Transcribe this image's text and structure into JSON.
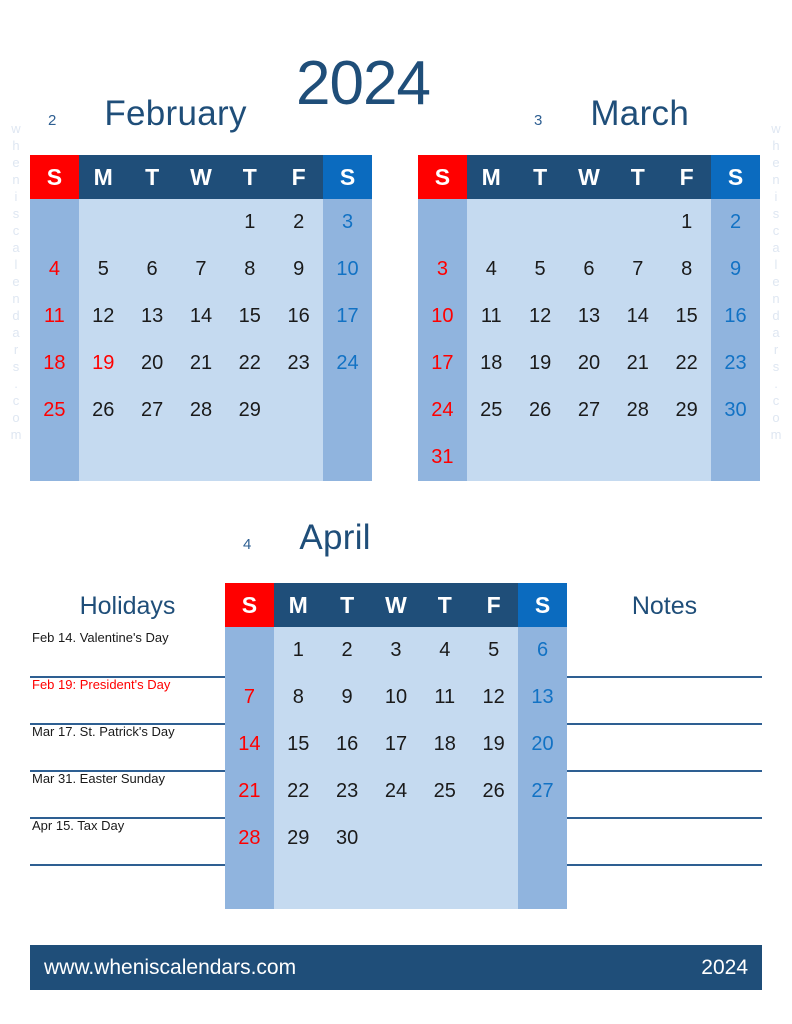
{
  "year": "2024",
  "watermark": "wheniscalendars.com",
  "weekdays": [
    "S",
    "M",
    "T",
    "W",
    "T",
    "F",
    "S"
  ],
  "months": [
    {
      "number": "2",
      "name": "February",
      "weeks": [
        [
          "",
          "",
          "",
          "",
          "1",
          "2",
          "3"
        ],
        [
          "4",
          "5",
          "6",
          "7",
          "8",
          "9",
          "10"
        ],
        [
          "11",
          "12",
          "13",
          "14",
          "15",
          "16",
          "17"
        ],
        [
          "18",
          "19",
          "20",
          "21",
          "22",
          "23",
          "24"
        ],
        [
          "25",
          "26",
          "27",
          "28",
          "29",
          "",
          ""
        ],
        [
          "",
          "",
          "",
          "",
          "",
          "",
          ""
        ]
      ],
      "holiday_cells": [
        [
          3,
          1
        ]
      ]
    },
    {
      "number": "3",
      "name": "March",
      "weeks": [
        [
          "",
          "",
          "",
          "",
          "",
          "1",
          "2"
        ],
        [
          "3",
          "4",
          "5",
          "6",
          "7",
          "8",
          "9"
        ],
        [
          "10",
          "11",
          "12",
          "13",
          "14",
          "15",
          "16"
        ],
        [
          "17",
          "18",
          "19",
          "20",
          "21",
          "22",
          "23"
        ],
        [
          "24",
          "25",
          "26",
          "27",
          "28",
          "29",
          "30"
        ],
        [
          "31",
          "",
          "",
          "",
          "",
          "",
          ""
        ]
      ],
      "holiday_cells": []
    },
    {
      "number": "4",
      "name": "April",
      "weeks": [
        [
          "",
          "1",
          "2",
          "3",
          "4",
          "5",
          "6"
        ],
        [
          "7",
          "8",
          "9",
          "10",
          "11",
          "12",
          "13"
        ],
        [
          "14",
          "15",
          "16",
          "17",
          "18",
          "19",
          "20"
        ],
        [
          "21",
          "22",
          "23",
          "24",
          "25",
          "26",
          "27"
        ],
        [
          "28",
          "29",
          "30",
          "",
          "",
          "",
          ""
        ],
        [
          "",
          "",
          "",
          "",
          "",
          "",
          ""
        ]
      ],
      "holiday_cells": []
    }
  ],
  "holidays": {
    "title": "Holidays",
    "items": [
      {
        "text": "Feb 14. Valentine's Day",
        "highlight": false
      },
      {
        "text": "Feb 19: President's Day",
        "highlight": true
      },
      {
        "text": "Mar 17. St. Patrick's Day",
        "highlight": false
      },
      {
        "text": "Mar 31. Easter Sunday",
        "highlight": false
      },
      {
        "text": "Apr 15. Tax Day",
        "highlight": false
      }
    ]
  },
  "notes": {
    "title": "Notes",
    "line_count": 5
  },
  "footer": {
    "website": "www.wheniscalendars.com",
    "year": "2024"
  },
  "colors": {
    "navy": "#1f4e79",
    "sunday_red": "#ff0000",
    "saturday_blue": "#0b6bbf",
    "weekend_cell": "#90b4de",
    "weekday_cell": "#c5daf0",
    "rule_line": "#2e5f92"
  }
}
